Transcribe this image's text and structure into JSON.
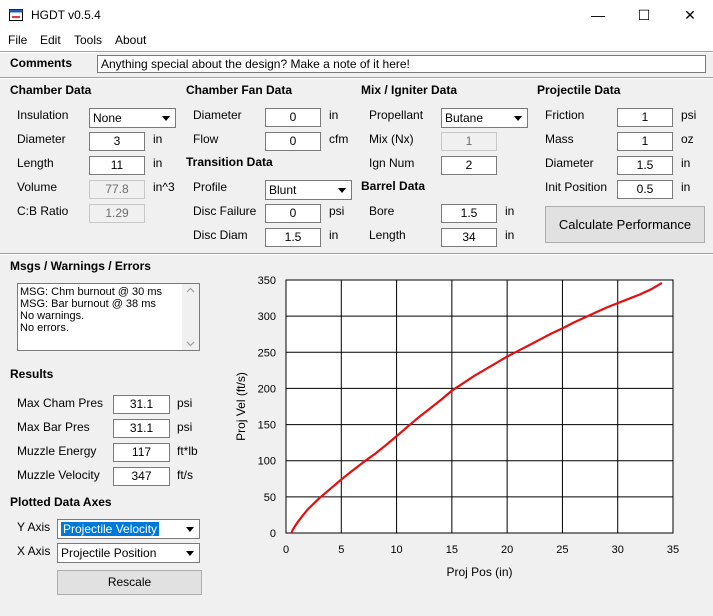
{
  "window": {
    "title": "HGDT v0.5.4",
    "minimize": "—",
    "maximize": "☐",
    "close": "✕"
  },
  "menu": [
    "File",
    "Edit",
    "Tools",
    "About"
  ],
  "comments": {
    "label": "Comments",
    "value": "Anything special about the design?  Make a note of it here!"
  },
  "chamber": {
    "header": "Chamber Data",
    "insulation_label": "Insulation",
    "insulation_value": "None",
    "diameter_label": "Diameter",
    "diameter_value": "3",
    "diameter_unit": "in",
    "length_label": "Length",
    "length_value": "11",
    "length_unit": "in",
    "volume_label": "Volume",
    "volume_value": "77.8",
    "volume_unit": "in^3",
    "cb_label": "C:B Ratio",
    "cb_value": "1.29"
  },
  "fan": {
    "header": "Chamber Fan Data",
    "diameter_label": "Diameter",
    "diameter_value": "0",
    "diameter_unit": "in",
    "flow_label": "Flow",
    "flow_value": "0",
    "flow_unit": "cfm"
  },
  "transition": {
    "header": "Transition Data",
    "profile_label": "Profile",
    "profile_value": "Blunt",
    "disc_failure_label": "Disc Failure",
    "disc_failure_value": "0",
    "disc_failure_unit": "psi",
    "disc_diam_label": "Disc Diam",
    "disc_diam_value": "1.5",
    "disc_diam_unit": "in"
  },
  "mix": {
    "header": "Mix / Igniter Data",
    "propellant_label": "Propellant",
    "propellant_value": "Butane",
    "mix_label": "Mix (Nx)",
    "mix_value": "1",
    "ign_label": "Ign Num",
    "ign_value": "2"
  },
  "barrel": {
    "header": "Barrel Data",
    "bore_label": "Bore",
    "bore_value": "1.5",
    "bore_unit": "in",
    "length_label": "Length",
    "length_value": "34",
    "length_unit": "in"
  },
  "projectile": {
    "header": "Projectile Data",
    "friction_label": "Friction",
    "friction_value": "1",
    "friction_unit": "psi",
    "mass_label": "Mass",
    "mass_value": "1",
    "mass_unit": "oz",
    "diameter_label": "Diameter",
    "diameter_value": "1.5",
    "diameter_unit": "in",
    "init_label": "Init Position",
    "init_value": "0.5",
    "init_unit": "in"
  },
  "calculate_label": "Calculate Performance",
  "msgs": {
    "header": "Msgs / Warnings / Errors",
    "lines": [
      "MSG: Chm burnout @ 30 ms",
      "MSG: Bar burnout @ 38 ms",
      "No warnings.",
      "No errors."
    ]
  },
  "results": {
    "header": "Results",
    "max_cham_label": "Max Cham Pres",
    "max_cham_value": "31.1",
    "max_cham_unit": "psi",
    "max_bar_label": "Max Bar Pres",
    "max_bar_value": "31.1",
    "max_bar_unit": "psi",
    "energy_label": "Muzzle Energy",
    "energy_value": "117",
    "energy_unit": "ft*lb",
    "velocity_label": "Muzzle Velocity",
    "velocity_value": "347",
    "velocity_unit": "ft/s"
  },
  "axes": {
    "header": "Plotted Data Axes",
    "y_label": "Y Axis",
    "y_value": "Projectile Velocity",
    "x_label": "X Axis",
    "x_value": "Projectile Position",
    "rescale_label": "Rescale"
  },
  "colors": {
    "curve": "#e31010",
    "selection": "#0078d7"
  },
  "chart_data": {
    "type": "line",
    "xlabel": "Proj Pos (in)",
    "ylabel": "Proj Vel (ft/s)",
    "xlim": [
      0,
      35
    ],
    "ylim": [
      0,
      350
    ],
    "xticks": [
      0,
      5,
      10,
      15,
      20,
      25,
      30,
      35
    ],
    "yticks": [
      0,
      50,
      100,
      150,
      200,
      250,
      300,
      350
    ],
    "grid": true,
    "series": [
      {
        "x": [
          0.5,
          0.6,
          0.8,
          1.0,
          1.5,
          2,
          3,
          4,
          5,
          6,
          7,
          8,
          9,
          10,
          11,
          12,
          13,
          14,
          15,
          16,
          17,
          18,
          19,
          20,
          21,
          22,
          23,
          24,
          25,
          26,
          27,
          28,
          29,
          30,
          31,
          32,
          33,
          34
        ],
        "y": [
          0,
          4,
          9,
          14,
          24,
          33,
          48,
          61,
          74,
          86,
          98,
          109,
          121,
          134,
          147,
          160,
          172,
          184,
          197,
          207,
          217,
          226,
          235,
          244,
          252,
          260,
          268,
          276,
          283,
          291,
          298,
          305,
          312,
          318,
          324,
          330,
          337,
          346
        ]
      }
    ]
  }
}
